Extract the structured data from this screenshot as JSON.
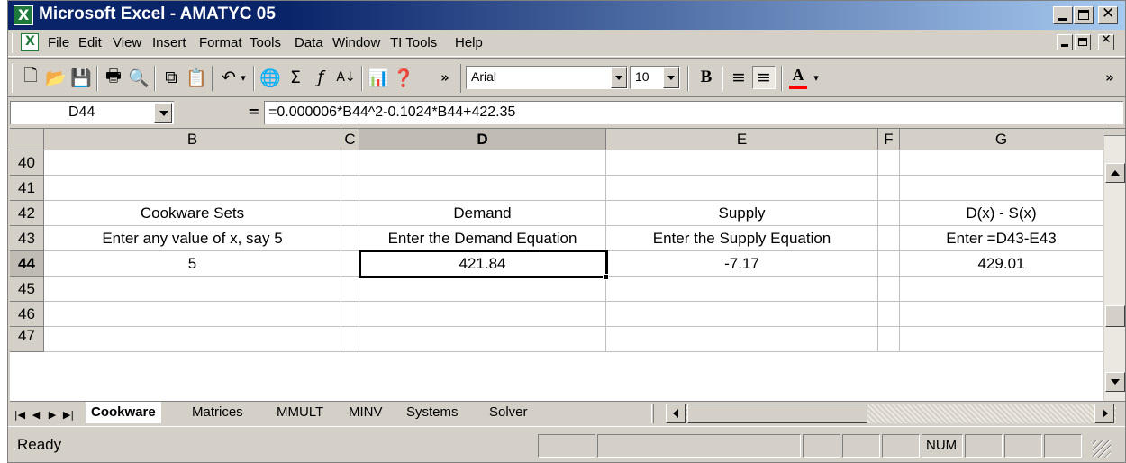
{
  "window": {
    "title": "Microsoft Excel - AMATYC 05",
    "min_label": "",
    "max_label": "",
    "close_label": "✕"
  },
  "menu": [
    "File",
    "Edit",
    "View",
    "Insert",
    "Format",
    "Tools",
    "Data",
    "Window",
    "TI Tools",
    "Help"
  ],
  "toolbar": {
    "font_name": "Arial",
    "font_size": "10",
    "bold_label": "B",
    "font_color": "#ff0000",
    "overflow_label": "»"
  },
  "formula_bar": {
    "cell_ref": "D44",
    "equals": "=",
    "formula": "=0.000006*B44^2-0.1024*B44+422.35"
  },
  "grid": {
    "columns": [
      "B",
      "C",
      "D",
      "E",
      "F",
      "G"
    ],
    "rows": [
      "40",
      "41",
      "42",
      "43",
      "44",
      "45",
      "46",
      "47"
    ],
    "cells": {
      "B42": "Cookware Sets",
      "D42": "Demand",
      "E42": "Supply",
      "G42": "D(x) - S(x)",
      "B43": "Enter any value of x, say 5",
      "D43": "Enter the Demand Equation",
      "E43": "Enter the Supply Equation",
      "G43": "Enter =D43-E43",
      "B44": "5",
      "D44": "421.84",
      "E44": "-7.17",
      "G44": "429.01"
    },
    "active_cell": "D44"
  },
  "sheets": {
    "tabs": [
      "Cookware",
      "Matrices",
      "MMULT",
      "MINV",
      "Systems",
      "Solver"
    ],
    "active": "Cookware"
  },
  "status": {
    "text": "Ready",
    "num": "NUM"
  }
}
